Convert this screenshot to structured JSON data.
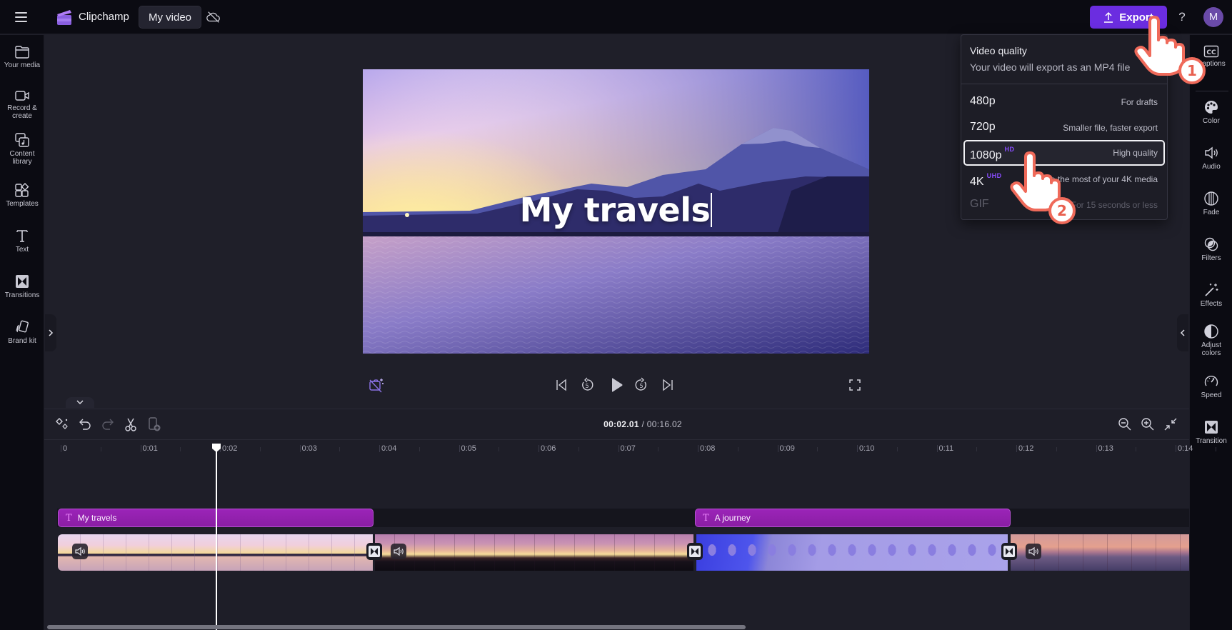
{
  "topbar": {
    "menu_icon": "hamburger-menu-icon",
    "app_name": "Clipchamp",
    "project_name": "My video",
    "sync_status_icon": "cloud-off-icon",
    "export_label": "Export",
    "help_label": "?",
    "avatar_initial": "M",
    "accent_color": "#6b2de0"
  },
  "left_sidebar": {
    "items": [
      {
        "label": "Your media",
        "icon": "folder-icon"
      },
      {
        "label": "Record &\ncreate",
        "icon": "camera-icon"
      },
      {
        "label": "Content\nlibrary",
        "icon": "content-library-icon"
      },
      {
        "label": "Templates",
        "icon": "templates-icon"
      },
      {
        "label": "Text",
        "icon": "text-icon"
      },
      {
        "label": "Transitions",
        "icon": "transitions-icon"
      },
      {
        "label": "Brand kit",
        "icon": "brand-kit-icon"
      }
    ]
  },
  "right_sidebar": {
    "items": [
      {
        "label": "Captions",
        "icon": "captions-icon"
      },
      {
        "label": "Color",
        "icon": "palette-icon"
      },
      {
        "label": "Audio",
        "icon": "speaker-icon"
      },
      {
        "label": "Fade",
        "icon": "fade-icon"
      },
      {
        "label": "Filters",
        "icon": "filters-icon"
      },
      {
        "label": "Effects",
        "icon": "magic-wand-icon"
      },
      {
        "label": "Adjust\ncolors",
        "icon": "adjust-colors-icon"
      },
      {
        "label": "Speed",
        "icon": "speedometer-icon"
      },
      {
        "label": "Transition",
        "icon": "transition-icon"
      }
    ]
  },
  "preview": {
    "overlay_text": "My travels"
  },
  "playback": {
    "skip_back_seconds": "5",
    "skip_forward_seconds": "5"
  },
  "timeline": {
    "current_time": "00:02.01",
    "separator": " / ",
    "total_time": "00:16.02",
    "ruler_labels": [
      "0",
      "0:01",
      "0:02",
      "0:03",
      "0:04",
      "0:05",
      "0:06",
      "0:07",
      "0:08",
      "0:09",
      "0:10",
      "0:11",
      "0:12",
      "0:13",
      "0:14"
    ],
    "playhead_seconds": 2.01,
    "text_clips": [
      {
        "label": "My travels",
        "start": 0,
        "end": 4.0
      },
      {
        "label": "A journey",
        "start": 8.0,
        "end": 12.0
      }
    ],
    "scroll_fraction_visible": 0.6
  },
  "export_menu": {
    "title": "Video quality",
    "subtitle": "Your video will export as an MP4 file",
    "options": [
      {
        "quality": "480p",
        "badge": "",
        "description": "For drafts",
        "state": "normal"
      },
      {
        "quality": "720p",
        "badge": "",
        "description": "Smaller file, faster export",
        "state": "normal"
      },
      {
        "quality": "1080p",
        "badge": "HD",
        "description": "High quality",
        "state": "selected"
      },
      {
        "quality": "4K",
        "badge": "UHD",
        "description": "Make the most of your 4K media",
        "state": "normal"
      },
      {
        "quality": "GIF",
        "badge": "",
        "description": "For 15 seconds or less",
        "state": "disabled"
      }
    ]
  },
  "callouts": [
    {
      "number": "1"
    },
    {
      "number": "2"
    }
  ]
}
